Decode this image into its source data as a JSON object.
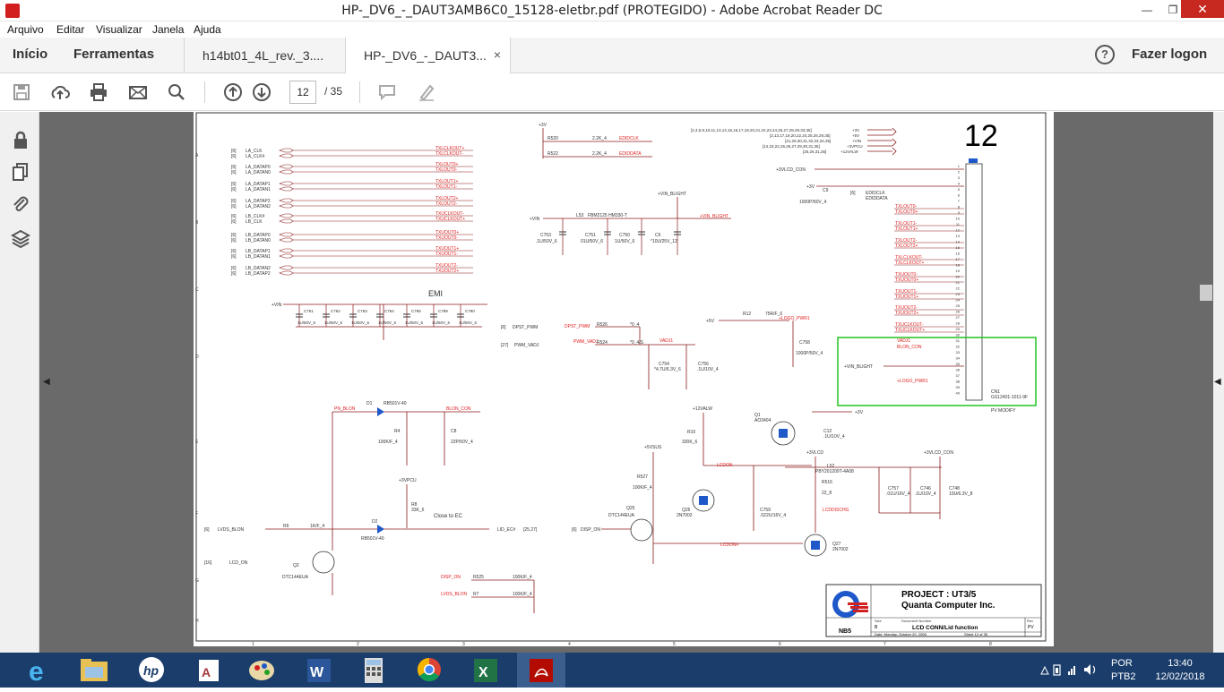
{
  "window": {
    "title": "HP-_DV6_-_DAUT3AMB6C0_15128-eletbr.pdf (PROTEGIDO) - Adobe Acrobat Reader DC",
    "controls": [
      "—",
      "❐",
      "✕"
    ]
  },
  "menu": [
    "Arquivo",
    "Editar",
    "Visualizar",
    "Janela",
    "Ajuda"
  ],
  "tabs": {
    "home": "Início",
    "tools": "Ferramentas",
    "docs": [
      {
        "label": "h14bt01_4L_rev._3...."
      },
      {
        "label": "HP-_DV6_-_DAUT3...",
        "close": "×"
      }
    ]
  },
  "account": {
    "login": "Fazer logon",
    "help": "?"
  },
  "toolbar": {
    "page_current": "12",
    "page_total": "/ 35"
  },
  "schematic": {
    "page_number": "12",
    "emi_label": "EMI",
    "close_to_ec": "Close to EC",
    "pv_modify": "PV MODIFY",
    "left_nets": [
      {
        "ref": "[6]",
        "name": "LA_CLK",
        "net": "TXLCLKOUT+"
      },
      {
        "ref": "[6]",
        "name": "LA_CLK#",
        "net": "TXLCLKOUT-"
      },
      {
        "ref": "[6]",
        "name": "LA_DATAP0",
        "net": "TXLOUT0+"
      },
      {
        "ref": "[6]",
        "name": "LA_DATAN0",
        "net": "TXLOUT0-"
      },
      {
        "ref": "[6]",
        "name": "LA_DATAP1",
        "net": "TXLOUT1+"
      },
      {
        "ref": "[6]",
        "name": "LA_DATAN1",
        "net": "TXLOUT1-"
      },
      {
        "ref": "[6]",
        "name": "LA_DATAP2",
        "net": "TXLOUT2+"
      },
      {
        "ref": "[6]",
        "name": "LA_DATAN2",
        "net": "TXLOUT2-"
      },
      {
        "ref": "[6]",
        "name": "LB_CLK#",
        "net": "TXUCLKOUT-"
      },
      {
        "ref": "[6]",
        "name": "LB_CLK",
        "net": "TXUCLKOUT+"
      },
      {
        "ref": "[6]",
        "name": "LB_DATAP0",
        "net": "TXUOUT0+"
      },
      {
        "ref": "[6]",
        "name": "LB_DATAN0",
        "net": "TXUOUT0-"
      },
      {
        "ref": "[6]",
        "name": "LB_DATAP1",
        "net": "TXUOUT1+"
      },
      {
        "ref": "[6]",
        "name": "LB_DATAN1",
        "net": "TXUOUT1-"
      },
      {
        "ref": "[6]",
        "name": "LB_DATAN2",
        "net": "TXUOUT2-"
      },
      {
        "ref": "[6]",
        "name": "LB_DATAP2",
        "net": "TXUOUT2+"
      }
    ],
    "emi_caps": [
      {
        "ref": "C761",
        "val": "1U/50V_6"
      },
      {
        "ref": "C762",
        "val": "1U/50V_6"
      },
      {
        "ref": "C763",
        "val": "1U/50V_6"
      },
      {
        "ref": "C764",
        "val": "1U/50V_6"
      },
      {
        "ref": "C765",
        "val": "1U/50V_6"
      },
      {
        "ref": "C789",
        "val": "1U/50V_6"
      },
      {
        "ref": "C790",
        "val": "1U/50V_6"
      }
    ],
    "connector_nets": [
      "TXLOUT0-",
      "TXLOUT0+",
      "TXLOUT1-",
      "TXLOUT1+",
      "TXLOUT2-",
      "TXLOUT2+",
      "TXLCLKOUT-",
      "TXLCLKOUT+",
      "TXUOUT0-",
      "TXUOUT0+",
      "TXUOUT1-",
      "TXUOUT1+",
      "TXUOUT2-",
      "TXUOUT2+",
      "TXUCLKOUT-",
      "TXUCLKOUT+"
    ],
    "connector": {
      "ref": "CN1",
      "part": "GS12401-1011-9F"
    },
    "labels": {
      "vin": "+VIN",
      "vin_blight": "+VIN_BLIGHT",
      "v3": "+3V",
      "v5": "+5V",
      "v12alw": "+12VALW",
      "v5vsus": "+5VSUS",
      "v3vlcd": "+3VLCD",
      "v3vpcu": "+3VPCU",
      "lcd_con": "+3VLCD_CON",
      "logo_pwr": "+LOGO_PWR1",
      "vadj": "VADJ1",
      "blon_con": "BLON_CON",
      "edidclk": "EDIDCLK",
      "ediddata": "EDIDDATA",
      "dpst_pwm": "DPST_PWM",
      "pwm_vadj": "PWM_VADJ",
      "lvds_blon": "LVDS_BLON",
      "lcd_on": "LCD_ON",
      "disp_on": "DISP_ON",
      "lid_ec": "LID_EC#",
      "lcdon": "LCDON",
      "lcdonb": "LCDON#",
      "lcddischg": "LCDDISCHG",
      "pn_blon": "PN_BLON"
    },
    "parts": [
      {
        "ref": "R520",
        "val": "2.2K_4"
      },
      {
        "ref": "R522",
        "val": "2.2K_4"
      },
      {
        "ref": "L53",
        "val": "FBM2125 HM330-T"
      },
      {
        "ref": "C753",
        "val": ".1U/50V_6"
      },
      {
        "ref": "C751",
        "val": "01U/50V_6"
      },
      {
        "ref": "C750",
        "val": "1U/50V_6"
      },
      {
        "ref": "C6",
        "val": "*10U/25V_12"
      },
      {
        "ref": "C9",
        "val": "1000P/50V_4"
      },
      {
        "ref": "R12",
        "val": "75R/F_6"
      },
      {
        "ref": "C758",
        "val": "1000P/50V_4"
      },
      {
        "ref": "R526",
        "val": "*0_4"
      },
      {
        "ref": "R524",
        "val": "*0_4/S"
      },
      {
        "ref": "C754",
        "val": "*4.7U/6.3V_6"
      },
      {
        "ref": "C756",
        "val": ".1U/10V_4"
      },
      {
        "ref": "D1",
        "val": "RB501V-40"
      },
      {
        "ref": "R4",
        "val": "100K/F_4"
      },
      {
        "ref": "C8",
        "val": "22P/50V_4"
      },
      {
        "ref": "R8",
        "val": "33K_6"
      },
      {
        "ref": "R6",
        "val": "1K/F_4"
      },
      {
        "ref": "D2",
        "val": "RB501V-40"
      },
      {
        "ref": "Q2",
        "val": "DTC144EUA"
      },
      {
        "ref": "R10",
        "val": "330K_6"
      },
      {
        "ref": "Q1",
        "val": "AO3404"
      },
      {
        "ref": "C12",
        "val": ".1U/10V_4"
      },
      {
        "ref": "R527",
        "val": "100K/F_4"
      },
      {
        "ref": "Q26",
        "val": "2N7002"
      },
      {
        "ref": "Q25",
        "val": "DTC144EUA"
      },
      {
        "ref": "L52",
        "val": "PBY201209T-4A08"
      },
      {
        "ref": "R516",
        "val": "22_8"
      },
      {
        "ref": "C759",
        "val": ".022U/16V_4"
      },
      {
        "ref": "Q27",
        "val": "2N7002"
      },
      {
        "ref": "C757",
        "val": ".01U/16V_4"
      },
      {
        "ref": "C746",
        "val": ".1U/10V_4"
      },
      {
        "ref": "C748",
        "val": "10U/6.3V_8"
      },
      {
        "ref": "R525",
        "val": "100K/F_4"
      },
      {
        "ref": "R7",
        "val": "100K/F_4"
      }
    ],
    "refs": {
      "pwm": "[6]",
      "vadj": "[27]",
      "lvds": "[6]",
      "lcd": "[16]",
      "disp": "[6]",
      "lid": "[25,27]",
      "edid": "[6]"
    },
    "power_refs": [
      "[2,4,6,9,10,11,13,14,15,16,17,19,20,21,22,23,24,26,27,28,29,33,35]",
      "[3,13,17,19,20,22,24,25,26,29,35]",
      "[21,29,30,31,32,33,34,35]",
      "[14,18,22,26,26,27,29,30,31,35]",
      "[25,26,31,35]"
    ],
    "power_rails": [
      "+3V",
      "+5V",
      "+VIN",
      "+3VPCU",
      "+12VALW"
    ],
    "title_block": {
      "project": "PROJECT : UT3/5",
      "company": "Quanta Computer Inc.",
      "size_label": "Size",
      "size": "B",
      "docnum_label": "Document Number",
      "document": "LCD CONN/Lid function",
      "rev_label": "Rev",
      "rev": "PV",
      "date": "Date: Monday, October 20, 2008",
      "sheet": "Sheet 12 of 35",
      "logo_text": "NB5"
    },
    "grid_cols": [
      "1",
      "2",
      "3",
      "4",
      "5",
      "6",
      "7",
      "8"
    ],
    "grid_rows": [
      "A",
      "B",
      "C",
      "D",
      "E",
      "F",
      "G",
      "H"
    ]
  },
  "taskbar": {
    "apps": [
      "ie-icon",
      "explorer-icon",
      "hp-icon",
      "access-icon",
      "paint-icon",
      "word-icon",
      "calculator-icon",
      "chrome-icon",
      "excel-icon",
      "acrobat-icon"
    ],
    "language": "POR",
    "keyboard": "PTB2",
    "time": "13:40",
    "date": "12/02/2018"
  },
  "colors": {
    "net_red": "#e02020",
    "wire": "#8b1a1a",
    "highlight": "#22c422",
    "taskbar": "#1a3d6b"
  }
}
